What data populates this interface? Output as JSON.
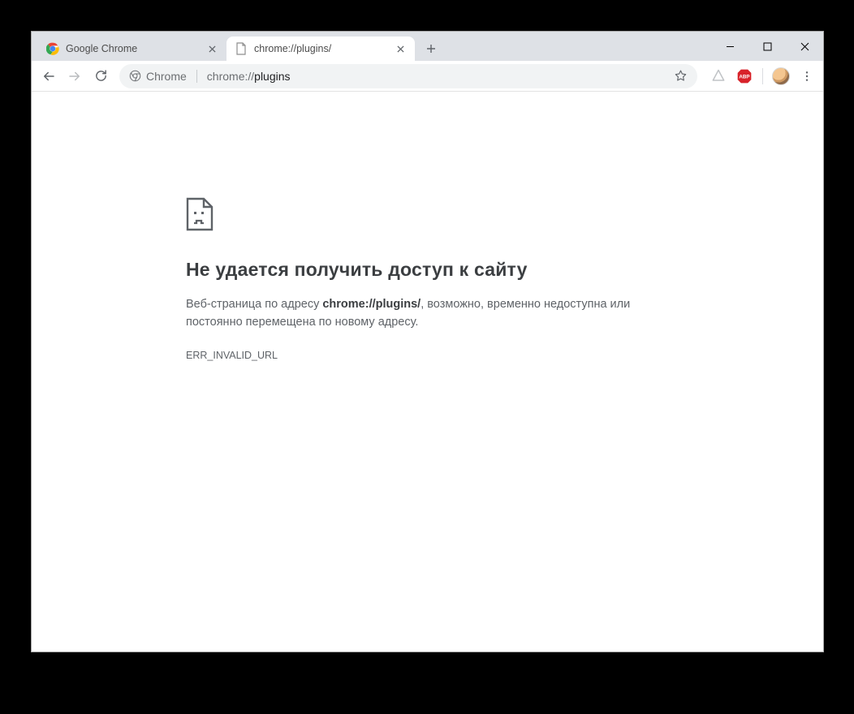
{
  "tabs": [
    {
      "title": "Google Chrome",
      "active": false
    },
    {
      "title": "chrome://plugins/",
      "active": true
    }
  ],
  "omnibox": {
    "chip_label": "Chrome",
    "url_dim": "chrome://",
    "url_strong": "plugins"
  },
  "error": {
    "title": "Не удается получить доступ к сайту",
    "msg_prefix": "Веб-страница по адресу ",
    "msg_url": "chrome://plugins/",
    "msg_suffix": ", возможно, временно недоступна или постоянно перемещена по новому адресу.",
    "code": "ERR_INVALID_URL"
  }
}
